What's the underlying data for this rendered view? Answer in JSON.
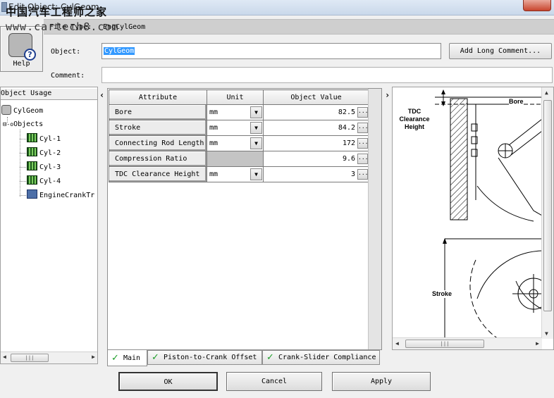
{
  "window": {
    "title": "Edit Object: CylGeom"
  },
  "watermark": {
    "cn_text": "中国汽车工程师之家",
    "url": "www.cartech8.com"
  },
  "help": {
    "label": "Help"
  },
  "file_type": {
    "label": "File Type:",
    "value": "EngCylGeom"
  },
  "object": {
    "label": "Object:",
    "value": "CylGeom"
  },
  "add_comment_label": "Add Long Comment...",
  "comment": {
    "label": "Comment:",
    "value": ""
  },
  "tree": {
    "header": "Object Usage",
    "root": "CylGeom",
    "group_label": "Objects",
    "children": [
      "Cyl-1",
      "Cyl-2",
      "Cyl-3",
      "Cyl-4",
      "EngineCrankTr"
    ]
  },
  "grid": {
    "headers": [
      "Attribute",
      "Unit",
      "Object Value"
    ],
    "rows": [
      {
        "attribute": "Bore",
        "unit": "mm",
        "value": "82.5"
      },
      {
        "attribute": "Stroke",
        "unit": "mm",
        "value": "84.2"
      },
      {
        "attribute": "Connecting Rod Length",
        "unit": "mm",
        "value": "172"
      },
      {
        "attribute": "Compression Ratio",
        "unit": "",
        "value": "9.6"
      },
      {
        "attribute": "TDC Clearance Height",
        "unit": "mm",
        "value": "3"
      }
    ]
  },
  "tabs": [
    "Main",
    "Piston-to-Crank Offset",
    "Crank-Slider Compliance"
  ],
  "diagram": {
    "bore_label": "Bore",
    "tdc_label_lines": [
      "TDC",
      "Clearance",
      "Height"
    ],
    "stroke_label": "Stroke"
  },
  "buttons": {
    "ok": "OK",
    "cancel": "Cancel",
    "apply": "Apply"
  }
}
